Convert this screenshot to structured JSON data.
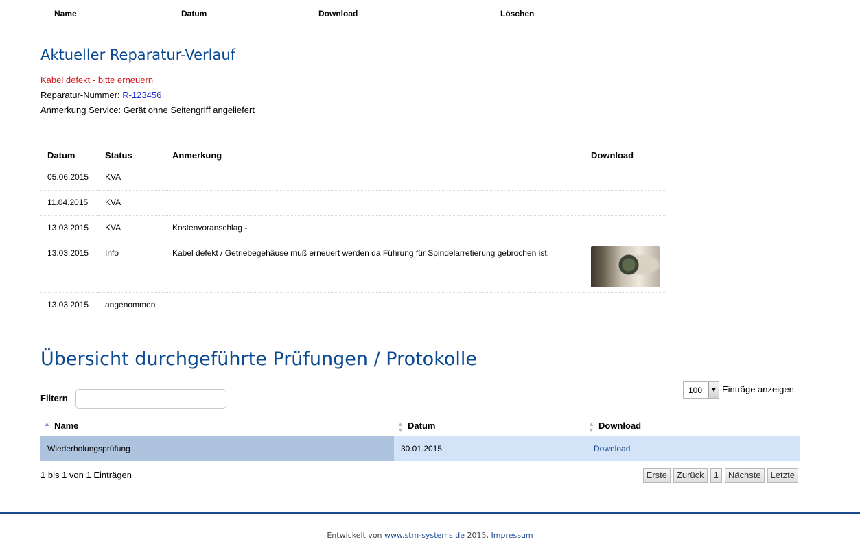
{
  "top_headers": {
    "name": "Name",
    "date": "Datum",
    "download": "Download",
    "delete": "Löschen"
  },
  "repair": {
    "title": "Aktueller Reparatur-Verlauf",
    "defect": "Kabel defekt - bitte erneuern",
    "number_label": "Reparatur-Nummer:",
    "number_value": "R-123456",
    "note": "Anmerkung Service: Gerät ohne Seitengriff angeliefert",
    "columns": [
      "Datum",
      "Status",
      "Anmerkung",
      "Download"
    ],
    "rows": [
      {
        "date": "05.06.2015",
        "status": "KVA",
        "note": ""
      },
      {
        "date": "11.04.2015",
        "status": "KVA",
        "note": ""
      },
      {
        "date": "13.03.2015",
        "status": "KVA",
        "note": "Kostenvoranschlag -"
      },
      {
        "date": "13.03.2015",
        "status": "Info",
        "note": "Kabel defekt / Getriebegehäuse muß erneuert werden da Führung für Spindelarretierung gebrochen ist."
      },
      {
        "date": "13.03.2015",
        "status": "angenommen",
        "note": ""
      }
    ]
  },
  "tests": {
    "title": "Übersicht durchgeführte Prüfungen / Protokolle",
    "filter_label": "Filtern",
    "filter_value": "",
    "page_length": "100",
    "page_length_label": "Einträge anzeigen",
    "columns": [
      "Name",
      "Datum",
      "Download"
    ],
    "rows": [
      {
        "name": "Wiederholungsprüfung",
        "date": "30.01.2015",
        "download": "Download"
      }
    ],
    "info": "1 bis 1 von 1 Einträgen",
    "pager": {
      "first": "Erste",
      "prev": "Zurück",
      "page": "1",
      "next": "Nächste",
      "last": "Letzte"
    }
  },
  "footer": {
    "prefix": "Entwickelt von",
    "link": "www.stm-systems.de",
    "year": "2015,",
    "imprint": "Impressum"
  },
  "colors": {
    "title_blue": "#0b4a91",
    "defect_red": "#d3141b",
    "number_blue": "#1a2fd6",
    "sorted_cell": "#aec3dd",
    "row_highlight": "#d3e4f9",
    "footer_line": "#1d4a8f"
  }
}
